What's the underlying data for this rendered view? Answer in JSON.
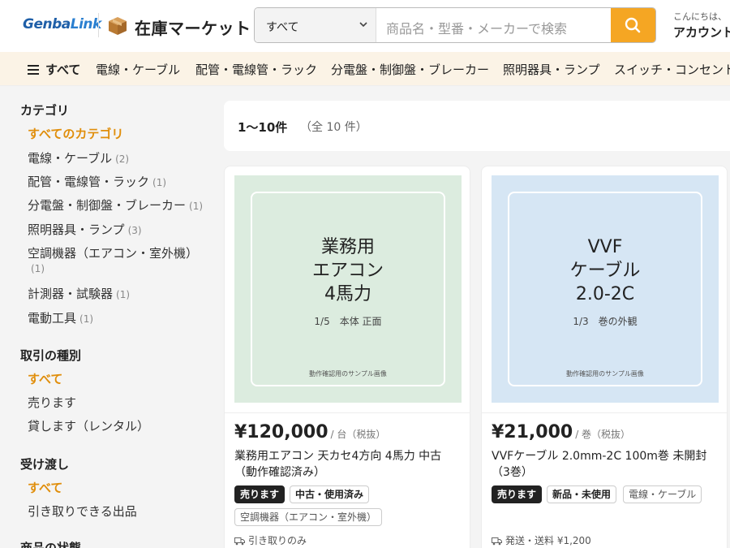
{
  "header": {
    "logo_text_a": "Genba",
    "logo_text_b": "Link",
    "site_name": "在庫マーケット",
    "search_scope": "すべて",
    "search_placeholder": "商品名・型番・メーカーで検索",
    "greeting": "こんにちは、",
    "account_label": "アカウント"
  },
  "nav": {
    "all": "すべて",
    "items": [
      "電線・ケーブル",
      "配管・電線管・ラック",
      "分電盤・制御盤・ブレーカー",
      "照明器具・ランプ",
      "スイッチ・コンセント"
    ]
  },
  "sidebar": {
    "category_heading": "カテゴリ",
    "categories": [
      {
        "label": "すべてのカテゴリ",
        "count": ""
      },
      {
        "label": "電線・ケーブル",
        "count": "(2)"
      },
      {
        "label": "配管・電線管・ラック",
        "count": "(1)"
      },
      {
        "label": "分電盤・制御盤・ブレーカー",
        "count": "(1)"
      },
      {
        "label": "照明器具・ランプ",
        "count": "(3)"
      },
      {
        "label": "空調機器（エアコン・室外機）",
        "count": "(1)"
      },
      {
        "label": "計測器・試験器",
        "count": "(1)"
      },
      {
        "label": "電動工具",
        "count": "(1)"
      }
    ],
    "deal_heading": "取引の種別",
    "deal_items": [
      "すべて",
      "売ります",
      "貸します（レンタル）"
    ],
    "delivery_heading": "受け渡し",
    "delivery_items": [
      "すべて",
      "引き取りできる出品"
    ],
    "condition_heading": "商品の状態"
  },
  "results": {
    "range": "1〜10件",
    "total": "（全 10 件）"
  },
  "products": [
    {
      "image_title_lines": [
        "業務用",
        "エアコン",
        "4馬力"
      ],
      "image_caption": "1/5　本体 正面",
      "image_note": "動作確認用のサンプル画像",
      "image_bg": "#dcecdf",
      "price": "¥120,000",
      "price_unit": "/ 台（税抜）",
      "title": "業務用エアコン 天カセ4方向 4馬力 中古（動作確認済み）",
      "deal_badge": "売ります",
      "condition_badge": "中古・使用済み",
      "category_badge": "空調機器（エアコン・室外機）",
      "shipping": "引き取りのみ"
    },
    {
      "image_title_lines": [
        "VVF",
        "ケーブル",
        "2.0-2C"
      ],
      "image_caption": "1/3　巻の外観",
      "image_note": "動作確認用のサンプル画像",
      "image_bg": "#d6e6f4",
      "price": "¥21,000",
      "price_unit": "/ 巻（税抜）",
      "title": "VVFケーブル 2.0mm-2C 100m巻 未開封（3巻）",
      "deal_badge": "売ります",
      "condition_badge": "新品・未使用",
      "category_badge": "電線・ケーブル",
      "shipping": "発送・送料 ¥1,200"
    }
  ],
  "colors": {
    "accent": "#f5a623",
    "active_link": "#e08e0b",
    "nav_bg": "#fbf3e6",
    "logo_blue": "#1f5fa8"
  }
}
